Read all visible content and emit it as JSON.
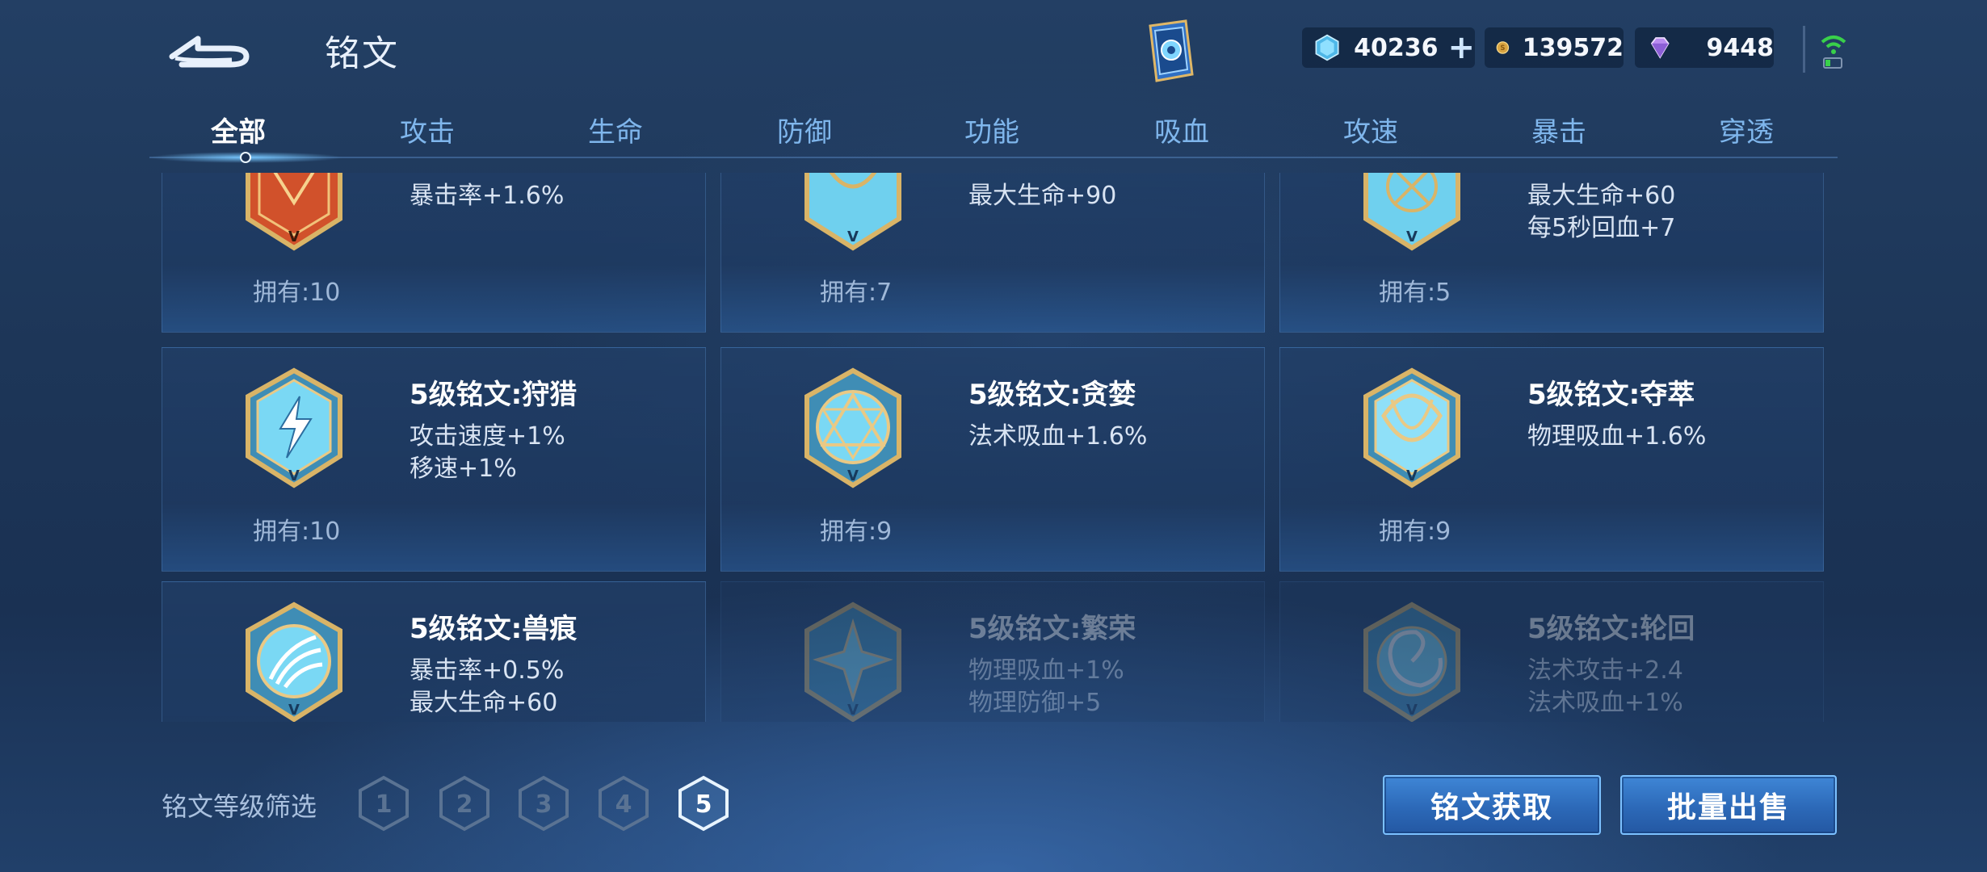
{
  "header": {
    "title": "铭文",
    "currencies": [
      {
        "name": "diamond",
        "value": "40236"
      },
      {
        "name": "gold",
        "value": "139572"
      },
      {
        "name": "gem",
        "value": "9448"
      }
    ]
  },
  "tabs": [
    {
      "label": "全部",
      "active": true
    },
    {
      "label": "攻击"
    },
    {
      "label": "生命"
    },
    {
      "label": "防御"
    },
    {
      "label": "功能"
    },
    {
      "label": "吸血"
    },
    {
      "label": "攻速"
    },
    {
      "label": "暴击"
    },
    {
      "label": "穿透"
    }
  ],
  "cards": [
    {
      "name": "",
      "stats": [
        "暴击率+1.6%"
      ],
      "owned": "拥有:10",
      "emblem": "red-crest",
      "color": "#c24a2a"
    },
    {
      "name": "",
      "stats": [
        "最大生命+90"
      ],
      "owned": "拥有:7",
      "emblem": "blue-crest",
      "color": "#6fd0ee"
    },
    {
      "name": "",
      "stats": [
        "最大生命+60",
        "每5秒回血+7"
      ],
      "owned": "拥有:5",
      "emblem": "blue-crest",
      "color": "#6fd0ee"
    },
    {
      "name": "5级铭文:狩猎",
      "stats": [
        "攻击速度+1%",
        "移速+1%"
      ],
      "owned": "拥有:10",
      "emblem": "lightning-crest",
      "color": "#6fd0ee"
    },
    {
      "name": "5级铭文:贪婪",
      "stats": [
        "法术吸血+1.6%"
      ],
      "owned": "拥有:9",
      "emblem": "triangle-crest",
      "color": "#6fd0ee"
    },
    {
      "name": "5级铭文:夺萃",
      "stats": [
        "物理吸血+1.6%"
      ],
      "owned": "拥有:9",
      "emblem": "knot-crest",
      "color": "#6fd0ee"
    },
    {
      "name": "5级铭文:兽痕",
      "stats": [
        "暴击率+0.5%",
        "最大生命+60"
      ],
      "owned": "",
      "emblem": "claw-crest",
      "color": "#6fd0ee"
    },
    {
      "name": "5级铭文:繁荣",
      "stats": [
        "物理吸血+1%",
        "物理防御+5"
      ],
      "owned": "",
      "emblem": "star-crest",
      "color": "#6fd0ee",
      "dim": true
    },
    {
      "name": "5级铭文:轮回",
      "stats": [
        "法术攻击+2.4",
        "法术吸血+1%"
      ],
      "owned": "",
      "emblem": "swirl-crest",
      "color": "#6fd0ee",
      "dim": true
    }
  ],
  "footer": {
    "filter_label": "铭文等级筛选",
    "levels": [
      "1",
      "2",
      "3",
      "4",
      "5"
    ],
    "selected_level": "5",
    "get_button": "铭文获取",
    "sell_button": "批量出售"
  }
}
